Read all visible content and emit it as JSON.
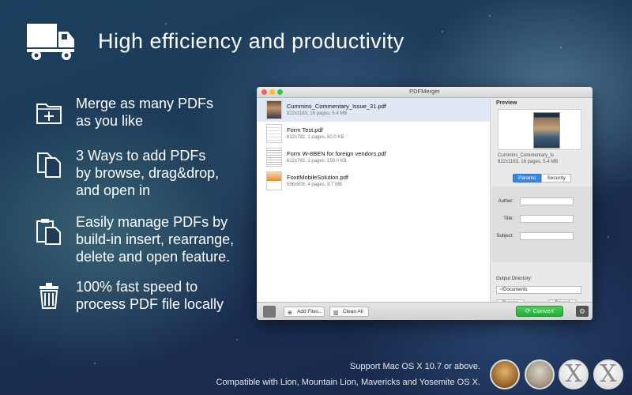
{
  "headline": "High efficiency and productivity",
  "features": [
    {
      "icon": "folder-plus-icon",
      "lines": [
        "Merge as many PDFs",
        "as you like"
      ]
    },
    {
      "icon": "documents-icon",
      "lines": [
        "3 Ways to add PDFs",
        "by browse, drag&drop,",
        "and open in"
      ]
    },
    {
      "icon": "clipboard-icon",
      "lines": [
        "Easily manage PDFs by",
        "build-in insert, rearrange,",
        "delete and open feature."
      ]
    },
    {
      "icon": "trash-icon",
      "lines": [
        "100% fast speed to",
        "process PDF file locally"
      ]
    }
  ],
  "window": {
    "title": "PDFMerger",
    "files": [
      {
        "name": "Cummins_Commentary_Issue_31.pdf",
        "meta": "822x1163, 16 pages, 5.4 MB",
        "selected": true
      },
      {
        "name": "Form Test.pdf",
        "meta": "612x792, 1 pages, 50.0 KB",
        "selected": false
      },
      {
        "name": "Form W-8BEN for foreign vendors.pdf",
        "meta": "612x792, 1 pages, 150.0 KB",
        "selected": false
      },
      {
        "name": "FoxitMobileSolution.pdf",
        "meta": "596x808, 4 pages, 8.7 MB",
        "selected": false
      }
    ],
    "preview": {
      "label": "Preview",
      "name": "Cummins_Commentary_Is",
      "meta": "822x1163, 16 pages, 5.4 MB",
      "tabs": [
        "Params",
        "Security"
      ],
      "fields": [
        "Auther:",
        "Title:",
        "Subject:"
      ],
      "output_label": "Output Directory:",
      "output_value": "~/Documents",
      "browse_label": "Browse",
      "reveal_label": "Reveal"
    },
    "toolbar": {
      "add_label": "Add Files...",
      "clear_label": "Clean All",
      "convert_label": "Convert"
    }
  },
  "footer": {
    "support": "Support Mac OS X 10.7 or above.",
    "compat": "Compatible with Lion, Mountain Lion, Mavericks and Yosemite OS X.",
    "badge_glyph": "X"
  },
  "colors": {
    "accent_blue": "#3b86df",
    "convert_green": "#2fb543",
    "selected_row": "#dfe8f4"
  }
}
